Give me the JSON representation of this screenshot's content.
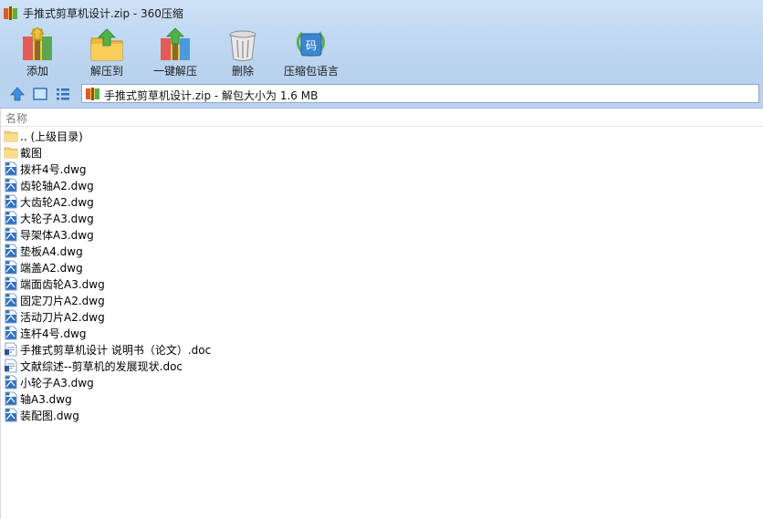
{
  "window": {
    "title": "手推式剪草机设计.zip - 360压缩"
  },
  "toolbar": {
    "buttons": [
      {
        "label": "添加",
        "icon": "add-archive-icon"
      },
      {
        "label": "解压到",
        "icon": "extract-to-icon"
      },
      {
        "label": "一键解压",
        "icon": "one-click-extract-icon"
      },
      {
        "label": "删除",
        "icon": "trash-icon"
      },
      {
        "label": "压缩包语言",
        "icon": "archive-language-icon"
      }
    ]
  },
  "address": {
    "text": "手推式剪草机设计.zip - 解包大小为 1.6 MB"
  },
  "list": {
    "column_name": "名称",
    "items": [
      {
        "name": ".. (上级目录)",
        "type": "folder"
      },
      {
        "name": "截图",
        "type": "folder"
      },
      {
        "name": "拨杆4号.dwg",
        "type": "dwg"
      },
      {
        "name": "齿轮轴A2.dwg",
        "type": "dwg"
      },
      {
        "name": "大齿轮A2.dwg",
        "type": "dwg"
      },
      {
        "name": "大轮子A3.dwg",
        "type": "dwg"
      },
      {
        "name": "导架体A3.dwg",
        "type": "dwg"
      },
      {
        "name": "垫板A4.dwg",
        "type": "dwg"
      },
      {
        "name": "端盖A2.dwg",
        "type": "dwg"
      },
      {
        "name": "端面齿轮A3.dwg",
        "type": "dwg"
      },
      {
        "name": "固定刀片A2.dwg",
        "type": "dwg"
      },
      {
        "name": "活动刀片A2.dwg",
        "type": "dwg"
      },
      {
        "name": "连杆4号.dwg",
        "type": "dwg"
      },
      {
        "name": "手推式剪草机设计 说明书（论文）.doc",
        "type": "doc"
      },
      {
        "name": "文献综述--剪草机的发展现状.doc",
        "type": "doc"
      },
      {
        "name": "小轮子A3.dwg",
        "type": "dwg"
      },
      {
        "name": "轴A3.dwg",
        "type": "dwg"
      },
      {
        "name": "装配图.dwg",
        "type": "dwg"
      }
    ]
  }
}
